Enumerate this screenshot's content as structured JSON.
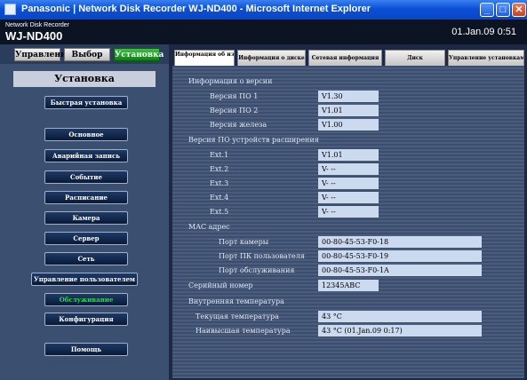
{
  "window": {
    "title": "Panasonic | Network Disk Recorder WJ-ND400 - Microsoft Internet Explorer"
  },
  "header": {
    "brand_small": "Network Disk Recorder",
    "model": "WJ-ND400",
    "datetime": "01.Jan.09  0:51"
  },
  "topnav": {
    "items": [
      {
        "label": "Управление"
      },
      {
        "label": "Выбор кам"
      },
      {
        "label": "Установка"
      }
    ]
  },
  "sidebar": {
    "title": "Установка",
    "items": [
      {
        "label": "Быстрая установка"
      },
      {
        "label": "Основное"
      },
      {
        "label": "Аварийная запись"
      },
      {
        "label": "Событие"
      },
      {
        "label": "Расписание"
      },
      {
        "label": "Камера"
      },
      {
        "label": "Сервер"
      },
      {
        "label": "Сеть"
      },
      {
        "label": "Управление пользователем"
      },
      {
        "label": "Обслуживание"
      },
      {
        "label": "Конфигурация"
      },
      {
        "label": "Помощь"
      }
    ]
  },
  "tabs": [
    {
      "label": "Информация об изделии"
    },
    {
      "label": "Информация о диске"
    },
    {
      "label": "Сетевая информация"
    },
    {
      "label": "Диск"
    },
    {
      "label": "Управление установками"
    }
  ],
  "info": {
    "sec_version": "Информация о версии",
    "sw1_label": "Версия ПО 1",
    "sw1_value": "V1.30",
    "sw2_label": "Версия ПО 2",
    "sw2_value": "V1.01",
    "hw_label": "Версия железа",
    "hw_value": "V1.00",
    "sec_ext": "Версия ПО устройств расширения",
    "ext1_label": "Ext.1",
    "ext1_value": "V1.01",
    "ext2_label": "Ext.2",
    "ext2_value": "V- --",
    "ext3_label": "Ext.3",
    "ext3_value": "V- --",
    "ext4_label": "Ext.4",
    "ext4_value": "V- --",
    "ext5_label": "Ext.5",
    "ext5_value": "V- --",
    "sec_mac": "MAC адрес",
    "cam_port_label": "Порт камеры",
    "cam_port_value": "00-80-45-53-F0-18",
    "pc_port_label": "Порт ПК пользователя",
    "pc_port_value": "00-80-45-53-F0-19",
    "svc_port_label": "Порт обслуживания",
    "svc_port_value": "00-80-45-53-F0-1A",
    "serial_label": "Серийный номер",
    "serial_value": "12345ABC",
    "sec_temp": "Внутренняя температура",
    "cur_temp_label": "Текущая температура",
    "cur_temp_value": "43 °C",
    "max_temp_label": "Наивысшая температура",
    "max_temp_value": "43 °C (01.Jan.09  0:17)"
  }
}
